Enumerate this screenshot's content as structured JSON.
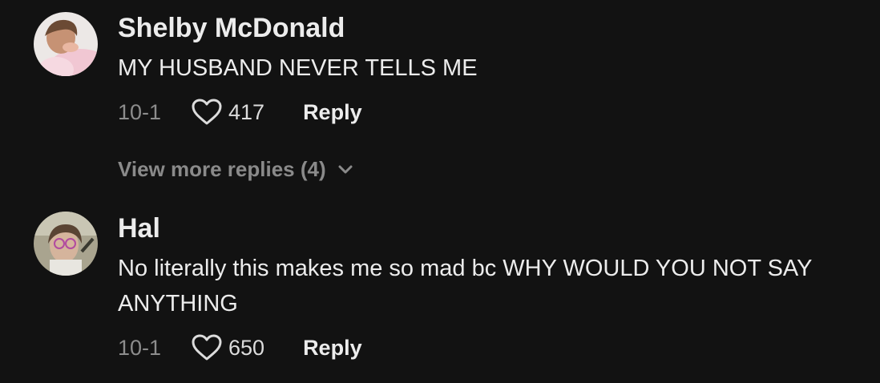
{
  "comments": [
    {
      "username": "Shelby McDonald",
      "text": "MY HUSBAND NEVER TELLS ME",
      "date": "10-1",
      "likes": "417",
      "reply_label": "Reply",
      "avatar_icon": "user-avatar-photo",
      "view_more_label": "View more replies (4)"
    },
    {
      "username": "Hal",
      "text": "No literally this makes me so mad bc WHY WOULD YOU NOT SAY ANYTHING",
      "date": "10-1",
      "likes": "650",
      "reply_label": "Reply",
      "avatar_icon": "user-avatar-photo"
    }
  ],
  "colors": {
    "background": "#121212",
    "primary_text": "#ececec",
    "secondary_text": "#8c8c8c"
  },
  "icons": {
    "like": "heart-outline-icon",
    "expand": "chevron-down-icon"
  }
}
